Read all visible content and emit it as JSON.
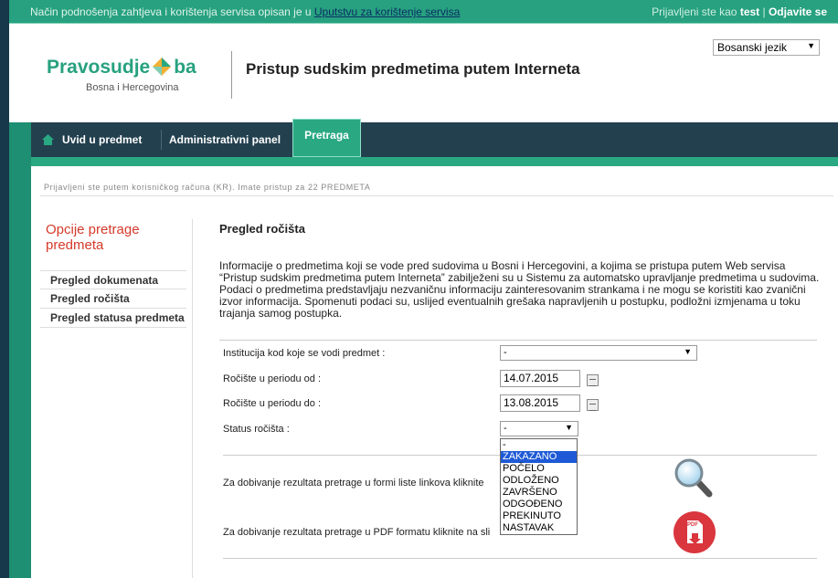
{
  "topbar": {
    "info_text": "Način podnošenja zahtjeva i korištenja servisa opisan je u ",
    "info_link": "Uputstvu za korištenje servisa",
    "logged_prefix": "Prijavljeni ste kao ",
    "user": "test",
    "separator": " | ",
    "logout": "Odjavite se"
  },
  "language": {
    "selected": "Bosanski jezik"
  },
  "logo": {
    "word_left": "Pravosudje",
    "word_right": "ba",
    "subtitle": "Bosna i Hercegovina"
  },
  "page_title": "Pristup sudskim predmetima putem Interneta",
  "nav": {
    "items": [
      "Uvid u predmet",
      "Administrativni panel",
      "Pretraga"
    ],
    "active_index": 2
  },
  "logged_info": "Prijavljeni ste putem korisničkog računa (KR). Imate pristup za 22 PREDMETA",
  "sidebar": {
    "title": "Opcije pretrage predmeta",
    "items": [
      "Pregled dokumenata",
      "Pregled ročišta",
      "Pregled statusa predmeta"
    ]
  },
  "main": {
    "title": "Pregled ročišta",
    "description": "Informacije o predmetima koji se vode pred sudovima u Bosni i Hercegovini, a kojima se pristupa putem Web servisa “Pristup sudskim predmetima putem Interneta” zabilježeni su u Sistemu za automatsko upravljanje predmetima u sudovima. Podaci o predmetima predstavljaju nezvaničnu informaciju zainteresovanim strankama i ne mogu se koristiti kao zvanični izvor informacija. Spomenuti podaci su, uslijed eventualnih grešaka napravljenih u postupku, podložni izmjenama u toku trajanja samog postupka."
  },
  "form": {
    "institution_label": "Institucija kod koje se vodi predmet :",
    "institution_value": "-",
    "date_from_label": "Ročište u periodu od :",
    "date_from_value": "14.07.2015",
    "date_to_label": "Ročište u periodu do :",
    "date_to_value": "13.08.2015",
    "status_label": "Status ročišta :",
    "status_value": "-",
    "status_options": [
      "-",
      "ZAKAZANO",
      "POČELO",
      "ODLOŽENO",
      "ZAVRŠENO",
      "ODGOĐENO",
      "PREKINUTO",
      "NASTAVAK"
    ],
    "status_highlighted": "ZAKAZANO"
  },
  "results": {
    "list_text": "Za dobivanje rezultata pretrage u formi liste linkova kliknite",
    "pdf_text": "Za dobivanje rezultata pretrage u PDF formatu kliknite na sli",
    "pdf_icon_text": "PDF"
  },
  "colors": {
    "accent": "#27a17f",
    "nav_bg": "#23404f",
    "sidebar_title": "#d43a2a",
    "pdf_red": "#d9363e",
    "highlight": "#1e5ad6"
  }
}
